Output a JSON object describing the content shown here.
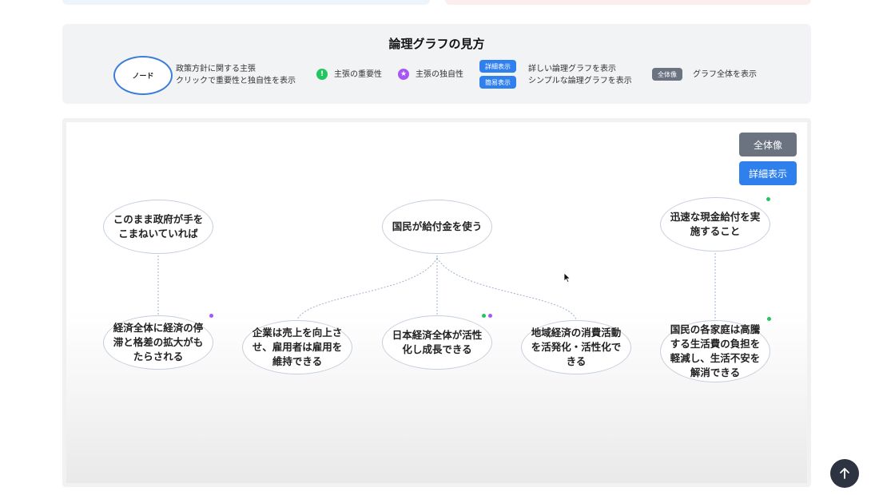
{
  "legend": {
    "title": "論理グラフの見方",
    "node_label": "ノード",
    "node_desc_line1": "政策方針に関する主張",
    "node_desc_line2": "クリックで重要性と独自性を表示",
    "importance_symbol": "!",
    "importance_label": "主張の重要性",
    "uniqueness_symbol": "★",
    "uniqueness_label": "主張の独自性",
    "detail_badge": "詳細表示",
    "detail_desc": "詳しい論理グラフを表示",
    "simple_badge": "簡易表示",
    "simple_desc": "シンプルな論理グラフを表示",
    "overall_badge": "全体像",
    "overall_desc": "グラフ全体を表示"
  },
  "controls": {
    "overall_button": "全体像",
    "detail_button": "詳細表示"
  },
  "graph": {
    "nodes": {
      "n1": "このまま政府が手をこまねいていれば",
      "n2": "国民が給付金を使う",
      "n3": "迅速な現金給付を実施すること",
      "n4": "経済全体に経済の停滞と格差の拡大がもたらされる",
      "n5": "企業は売上を向上させ、雇用者は雇用を維持できる",
      "n6": "日本経済全体が活性化し成長できる",
      "n7": "地域経済の消費活動を活発化・活性化できる",
      "n8": "国民の各家庭は高騰する生活費の負担を軽減し、生活不安を解消できる"
    }
  },
  "colors": {
    "accent_blue": "#2f80ed",
    "importance_green": "#22c55e",
    "uniqueness_purple": "#a855f7",
    "gray_button": "#6b7280"
  },
  "icons": {
    "scroll_top": "arrow-up-icon",
    "cursor": "mouse-pointer-icon"
  }
}
